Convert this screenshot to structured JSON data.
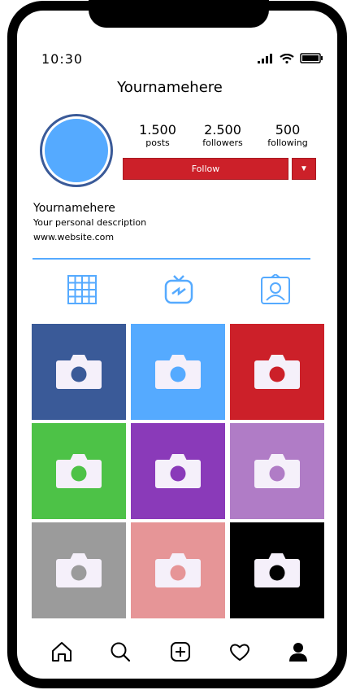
{
  "status_bar": {
    "time": "10:30",
    "icons": [
      "signal-icon",
      "wifi-icon",
      "battery-icon"
    ]
  },
  "profile": {
    "username": "Yournamehere",
    "stats": [
      {
        "value": "1.500",
        "label": "posts"
      },
      {
        "value": "2.500",
        "label": "followers"
      },
      {
        "value": "500",
        "label": "following"
      }
    ],
    "follow_label": "Follow",
    "dropdown_label": "▼",
    "bio": {
      "name": "Yournamehere",
      "description": "Your personal description",
      "website": "www.website.com"
    }
  },
  "tabs": [
    {
      "name": "grid-icon",
      "active": true
    },
    {
      "name": "igtv-icon",
      "active": false
    },
    {
      "name": "tagged-icon",
      "active": false
    }
  ],
  "posts": [
    {
      "color": "#3a5a98"
    },
    {
      "color": "#55aaff"
    },
    {
      "color": "#cc2029"
    },
    {
      "color": "#4dc247"
    },
    {
      "color": "#8a3ab9"
    },
    {
      "color": "#b07cc6"
    },
    {
      "color": "#9b9b9b"
    },
    {
      "color": "#e69597"
    },
    {
      "color": "#000000"
    }
  ],
  "nav": [
    "home-icon",
    "search-icon",
    "add-post-icon",
    "activity-heart-icon",
    "profile-icon"
  ],
  "colors": {
    "accent": "#55aaff",
    "follow": "#cc2029",
    "icon_fill": "#f5f0fa"
  }
}
